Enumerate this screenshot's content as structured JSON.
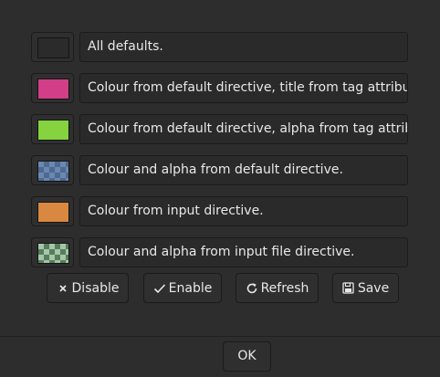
{
  "rows": [
    {
      "label": "All defaults.",
      "swatch": "#2b2b2b",
      "pattern": "none"
    },
    {
      "label": "Colour from default directive, title from tag attribute.",
      "swatch": "#d23f88",
      "pattern": "none"
    },
    {
      "label": "Colour from default directive, alpha from tag attribute.",
      "swatch": "#84d33f",
      "pattern": "none"
    },
    {
      "label": "Colour and alpha from default directive.",
      "swatch": "#6c88b0",
      "pattern": "checker-blue"
    },
    {
      "label": "Colour from input directive.",
      "swatch": "#d88840",
      "pattern": "none"
    },
    {
      "label": "Colour and alpha from input file directive.",
      "swatch": "#a7c5a9",
      "pattern": "checker-green"
    }
  ],
  "buttons": {
    "disable": {
      "label": "Disable",
      "icon": "close-icon"
    },
    "enable": {
      "label": "Enable",
      "icon": "check-icon"
    },
    "refresh": {
      "label": "Refresh",
      "icon": "refresh-icon"
    },
    "save": {
      "label": "Save",
      "icon": "save-icon"
    }
  },
  "ok_label": "OK"
}
